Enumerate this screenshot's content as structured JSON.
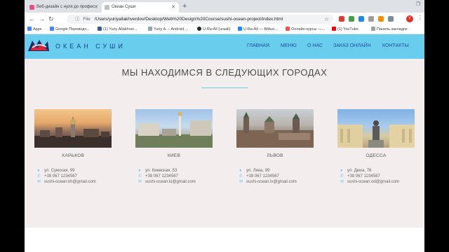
{
  "browser": {
    "tabs": [
      {
        "title": "Веб-дизайн с нуля до профес"
      },
      {
        "title": "Океан Суши"
      }
    ],
    "new_tab_symbol": "+",
    "address": {
      "scheme_label": "File",
      "path": "/Users/yuriyallakhverdov/Desktop/Web%20Design%20Course/sushi-ocean-project/index.html"
    },
    "profile_initial": "Y",
    "bookmarks": [
      {
        "label": "Apps"
      },
      {
        "label": "Google Переводч..."
      },
      {
        "label": "(1) Yuriy Allakhver..."
      },
      {
        "label": "Yuriy A. – Android ..."
      },
      {
        "label": "U-Ra-All (uraall)"
      },
      {
        "label": "U-Ra-All — Bitbuc..."
      },
      {
        "label": "Онлайн-курсы —..."
      },
      {
        "label": "(1) YouTube"
      },
      {
        "label": "Панель закладок"
      }
    ]
  },
  "site": {
    "brand": "ОКЕАН СУШИ",
    "menu": [
      "ГЛАВНАЯ",
      "МЕНЮ",
      "О НАС",
      "ЗАКАЗ ОНЛАЙН",
      "КОНТАКТЫ"
    ],
    "heading": "МЫ НАХОДИМСЯ В СЛЕДУЮЩИХ ГОРОДАХ",
    "cities": [
      {
        "name": "ХАРЬКОВ",
        "address": "ул. Сумская, 99",
        "phone": "+38 067 1234567",
        "email": "sushi-ocean.kh@gmail.com"
      },
      {
        "name": "КИЕВ",
        "address": "ул. Киевская, 53",
        "phone": "+38 067 1234567",
        "email": "sushi-ocean.ki@gmail.com"
      },
      {
        "name": "ЛЬВОВ",
        "address": "ул. Лева, 99",
        "phone": "+38 067 1234567",
        "email": "sushi-ocean.lv@gmail.com"
      },
      {
        "name": "ОДЕССА",
        "address": "ул. Дюка, 76",
        "phone": "+38 067 1234567",
        "email": "sushi-ocean.od@gmail.com"
      }
    ]
  },
  "colors": {
    "navbar": "#69cdee",
    "page_background": "#f4eded",
    "brand_text": "#1b3f8f",
    "accent": "#69cdee"
  },
  "icons": {
    "address": "map-marker-icon",
    "phone": "phone-icon",
    "email": "envelope-icon"
  }
}
